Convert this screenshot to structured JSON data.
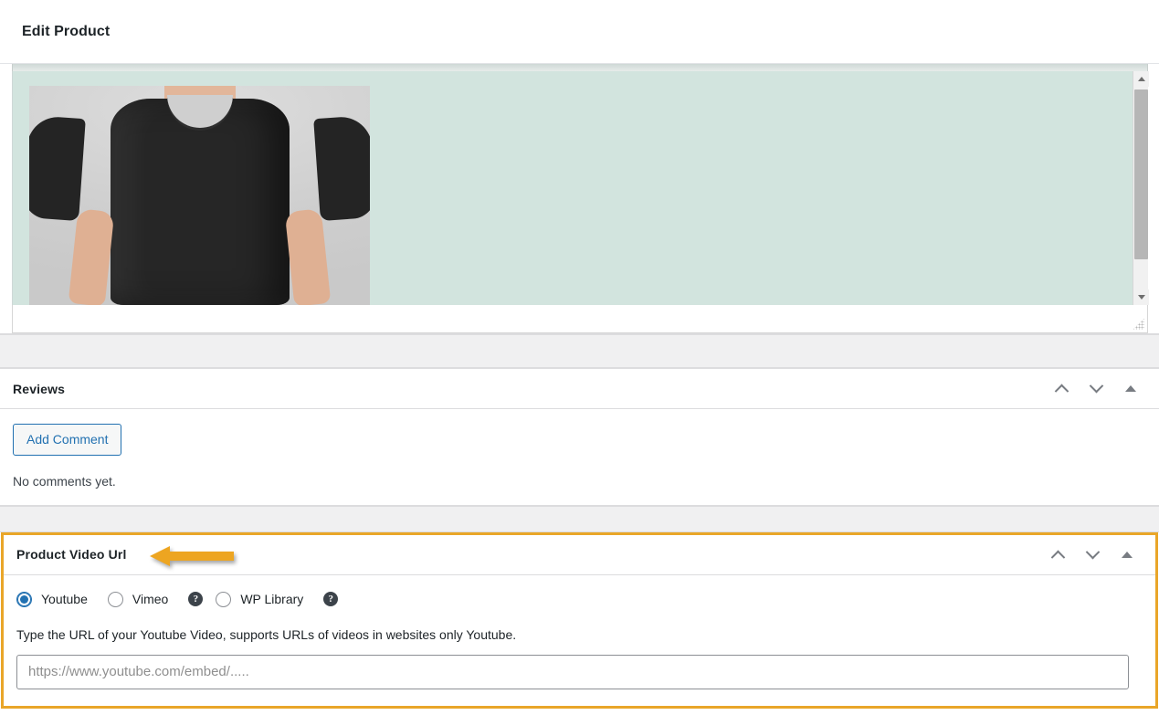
{
  "header": {
    "title": "Edit Product"
  },
  "editor": {
    "name": "product-description-editor",
    "image_alt": "Man wearing a plain black t-shirt",
    "scrollbar": {
      "up_icon": "scroll-up-arrow",
      "down_icon": "scroll-down-arrow"
    },
    "resize_grip_icon": "resize-grip-icon"
  },
  "reviews": {
    "title": "Reviews",
    "add_comment_label": "Add Comment",
    "empty_text": "No comments yet.",
    "controls": {
      "move_up_icon": "chevron-up-icon",
      "move_down_icon": "chevron-down-icon",
      "toggle_icon": "triangle-up-icon"
    }
  },
  "video_box": {
    "title": "Product Video Url",
    "highlight_color": "#e9a629",
    "annotation_arrow_icon": "left-pointing-arrow-annotation",
    "controls": {
      "move_up_icon": "chevron-up-icon",
      "move_down_icon": "chevron-down-icon",
      "toggle_icon": "triangle-up-icon"
    },
    "sources": [
      {
        "label": "Youtube",
        "selected": true,
        "help": false
      },
      {
        "label": "Vimeo",
        "selected": false,
        "help": true
      },
      {
        "label": "WP Library",
        "selected": false,
        "help": true
      }
    ],
    "help_glyph": "?",
    "description": "Type the URL of your Youtube Video, supports URLs of videos in websites only Youtube.",
    "url_placeholder": "https://www.youtube.com/embed/.....",
    "url_value": ""
  }
}
